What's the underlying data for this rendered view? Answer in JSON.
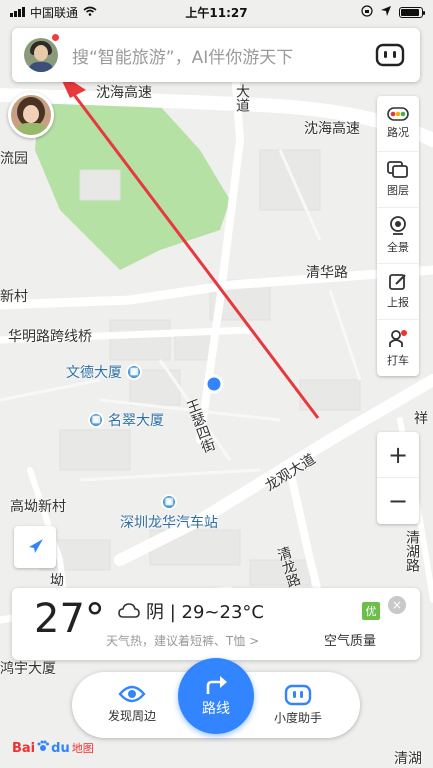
{
  "status_bar": {
    "carrier": "中国联通",
    "time": "上午11:27",
    "battery_level": 0.9
  },
  "search": {
    "placeholder": "搜“智能旅游”，AI伴你游天下",
    "robot_icon": "robot-face-icon"
  },
  "side_tools": [
    {
      "label": "路况",
      "icon": "traffic-icon"
    },
    {
      "label": "图层",
      "icon": "layers-icon"
    },
    {
      "label": "全景",
      "icon": "panorama-icon"
    },
    {
      "label": "上报",
      "icon": "report-icon"
    },
    {
      "label": "打车",
      "icon": "taxi-icon"
    }
  ],
  "zoom": {
    "in_label": "+",
    "out_label": "−"
  },
  "map_labels": {
    "road_shenhai_1": "沈海高速",
    "road_shenhai_2": "沈海高速",
    "road_dadao": "大道",
    "road_qinghua": "清华路",
    "road_huaming_bridge": "华明路跨线桥",
    "road_longguan": "龙观大道",
    "road_wangmu": "王瑟四街",
    "road_qinglong": "清龙路",
    "road_qinghu": "清湖路",
    "place_liuyuan": "流园",
    "place_xincun": "新村",
    "place_gaoao": "高坳新村",
    "place_honghua": "鸿宇大厦",
    "place_qinghu_right": "清湖",
    "place_xiang": "祥",
    "place_wei": "坳"
  },
  "pois": [
    {
      "name": "文德大厦"
    },
    {
      "name": "名翠大厦"
    },
    {
      "name": "深圳龙华汽车站"
    }
  ],
  "weather": {
    "temperature": "27°",
    "condition": "阴 | 29~23°C",
    "tip": "天气热，建议着短裤、T恤 >",
    "air_quality_badge": "优",
    "air_quality_label": "空气质量",
    "close_symbol": "×"
  },
  "bottom_bar": {
    "discover": "发现周边",
    "route": "路线",
    "assistant": "小度助手"
  },
  "logo": {
    "bai": "Bai",
    "du": "du",
    "ditu": "地图"
  },
  "colors": {
    "accent": "#3385ff",
    "arrow": "#e8383d",
    "park": "#b5e1a5",
    "road": "#ffffff",
    "map_bg": "#efefed"
  }
}
